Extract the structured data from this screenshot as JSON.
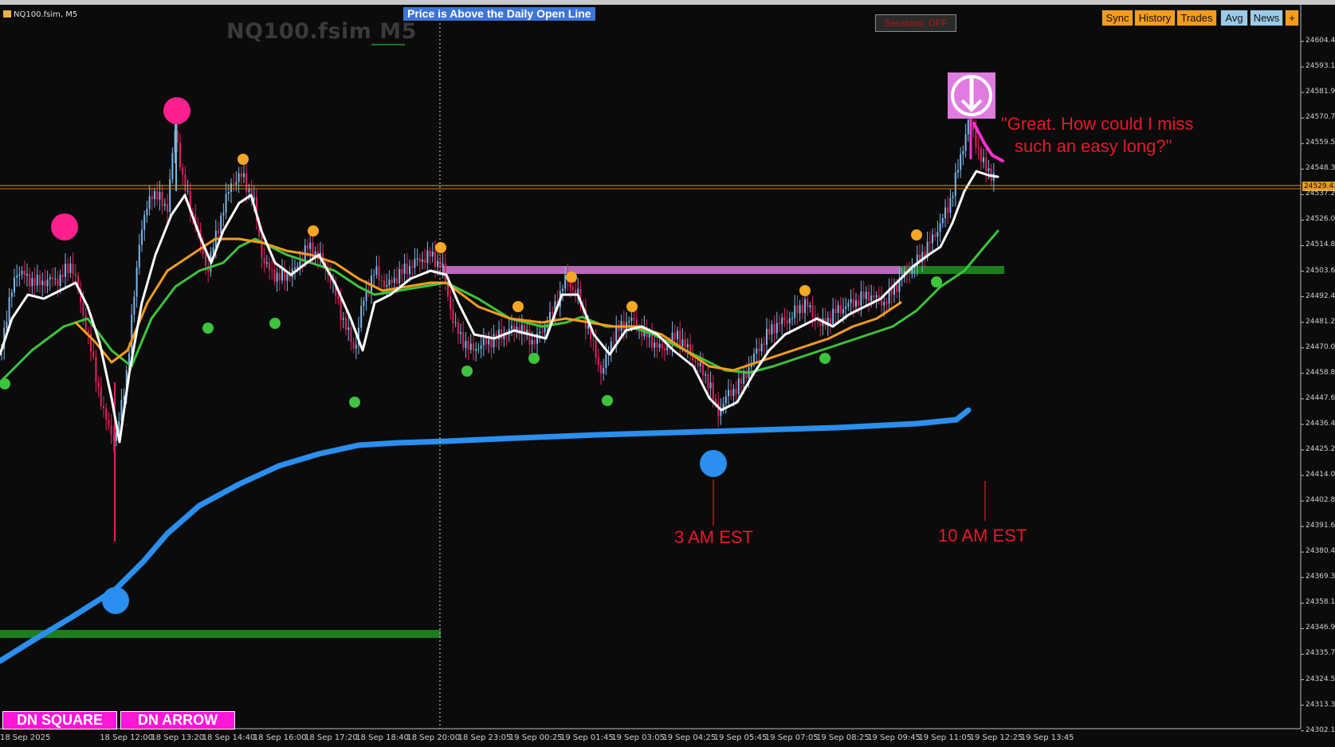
{
  "window": {
    "symbol_label": "NQ100.fsim, M5",
    "watermark": "NQ100.fsim M5"
  },
  "banner": {
    "text": "Price is Above the Daily Open Line"
  },
  "sessions_button": {
    "label": "Sessions: OFF"
  },
  "toolbar": {
    "buttons": [
      {
        "label": "Sync"
      },
      {
        "label": "History"
      },
      {
        "label": "Trades"
      },
      {
        "label": "Avg"
      },
      {
        "label": "News"
      },
      {
        "label": "+"
      }
    ]
  },
  "annotations": {
    "quote_line1": "\"Great. How could I miss",
    "quote_line2": "such an easy long?\"",
    "label_3am": "3 AM EST",
    "label_10am": "10 AM EST"
  },
  "panel_buttons": [
    {
      "label": "DN SQUARE"
    },
    {
      "label": "DN ARROW"
    }
  ],
  "current_price": "24529.43",
  "x_axis_labels": [
    "18 Sep 2025",
    "18 Sep 12:00",
    "18 Sep 13:20",
    "18 Sep 14:40",
    "18 Sep 16:00",
    "18 Sep 17:20",
    "18 Sep 18:40",
    "18 Sep 20:00",
    "18 Sep 23:05",
    "19 Sep 00:25",
    "19 Sep 01:45",
    "19 Sep 03:05",
    "19 Sep 04:25",
    "19 Sep 05:45",
    "19 Sep 07:05",
    "19 Sep 08:25",
    "19 Sep 09:45",
    "19 Sep 11:05",
    "19 Sep 12:25",
    "19 Sep 13:45"
  ],
  "y_axis_labels": [
    "24604.45",
    "24593.16",
    "24581.97",
    "24570.78",
    "24559.59",
    "24548.39",
    "24537.20",
    "24526.00",
    "24514.81",
    "24503.62",
    "24492.42",
    "24481.23",
    "24470.04",
    "24458.85",
    "24447.65",
    "24436.46",
    "24425.27",
    "24414.07",
    "24402.88",
    "24391.69",
    "24380.49",
    "24369.30",
    "24358.11",
    "24346.92",
    "24335.72",
    "24324.53",
    "24313.34",
    "24302.14"
  ],
  "colors": {
    "background": "#0b0b0b",
    "bull_candle": "#7fb6e8",
    "bear_candle": "#e0245e",
    "fast_ma": "#ffffff",
    "ma_orange": "#f39c1f",
    "ma_green": "#3cc43c",
    "slow_ma": "#2a8fef",
    "zone_pink": "#d67ad6",
    "zone_green": "#1f8a1f",
    "signal_pink": "#ff1f8e",
    "signal_blue": "#2a8fef",
    "dot_orange": "#f5a623",
    "dot_green": "#3cc43c",
    "annotation_red": "#e8182a",
    "price_line": "#e99a1f"
  },
  "icons": {
    "arrow_signal": "down-arrow-in-circle-icon"
  }
}
